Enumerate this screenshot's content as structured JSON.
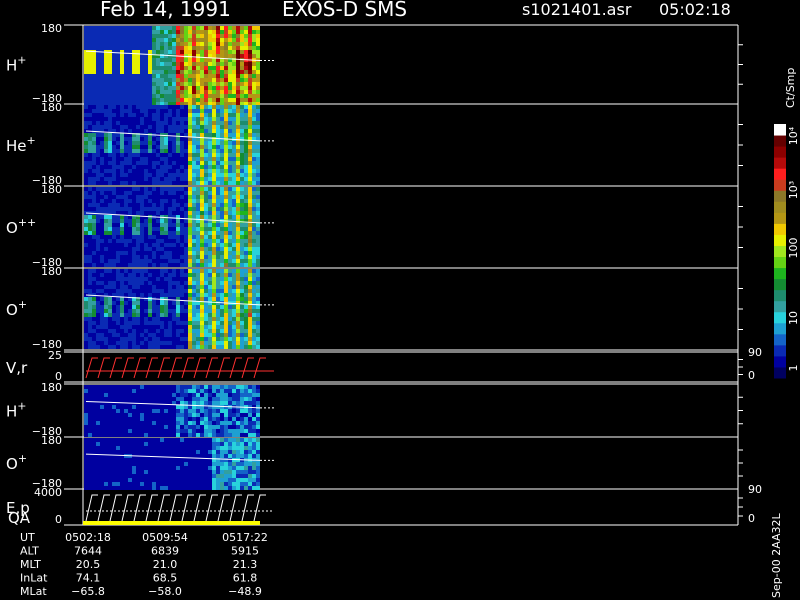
{
  "header": {
    "date": "Feb 14, 1991",
    "instrument": "EXOS-D SMS",
    "file": "s1021401.asr",
    "time": "05:02:18"
  },
  "colors": {
    "background": "#000000",
    "axis": "#ffffff",
    "line": "#ffffff",
    "vr_series": "#ff3030",
    "qa_bar": "#ffff00"
  },
  "colorbar": {
    "unit": "Ct/Smp",
    "tick_labels": [
      "1",
      "10",
      "100",
      "10³",
      "10⁴"
    ],
    "colors": [
      "#000060",
      "#0000a0",
      "#0a2ab4",
      "#1464c8",
      "#1ea0d2",
      "#28d2dc",
      "#32a0a0",
      "#1e8c6e",
      "#148c32",
      "#1eb41e",
      "#64d214",
      "#a0e61e",
      "#e6f000",
      "#f0c800",
      "#b49614",
      "#a08c1e",
      "#8c7828",
      "#c83c1e",
      "#ff1e1e",
      "#b40a0a",
      "#8c0000",
      "#640000",
      "#ffffff"
    ]
  },
  "footer": {
    "rows": [
      {
        "label": "UT",
        "values": [
          "0502:18",
          "0509:54",
          "0517:22"
        ]
      },
      {
        "label": "ALT",
        "values": [
          "7644",
          "6839",
          "5915"
        ]
      },
      {
        "label": "MLT",
        "values": [
          "20.5",
          "21.0",
          "21.3"
        ]
      },
      {
        "label": "InLat",
        "values": [
          "74.1",
          "68.5",
          "61.8"
        ]
      },
      {
        "label": "MLat",
        "values": [
          "−65.8",
          "−58.0",
          "−48.9"
        ]
      }
    ],
    "side_label": "Sep-00  2AA32L"
  },
  "chart_data": {
    "type": "heatmap",
    "time_axis_ticks": [
      "0502:18",
      "0509:54",
      "0517:22"
    ],
    "data_end_time": "0517:22",
    "panels": [
      {
        "label": "H",
        "sup": "+",
        "ymax": "180",
        "ymin": "−180",
        "type": "spectrogram",
        "profile": "strong"
      },
      {
        "label": "He",
        "sup": "+",
        "ymax": "180",
        "ymin": "−180",
        "type": "spectrogram",
        "profile": "medium"
      },
      {
        "label": "O",
        "sup": "++",
        "ymax": "180",
        "ymin": "−180",
        "type": "spectrogram",
        "profile": "medium"
      },
      {
        "label": "O",
        "sup": "+",
        "ymax": "180",
        "ymin": "−180",
        "type": "spectrogram",
        "profile": "medium"
      },
      {
        "label": "V,r",
        "sup": "",
        "ymax": "25",
        "ymin": "0",
        "right_max": "90",
        "right_min": "0",
        "type": "sawtooth",
        "color": "#ff3030"
      },
      {
        "label": "H",
        "sup": "+",
        "ymax": "180",
        "ymin": "−180",
        "type": "spectrogram",
        "profile": "weak"
      },
      {
        "label": "O",
        "sup": "+",
        "ymax": "180",
        "ymin": "−180",
        "type": "spectrogram",
        "profile": "late"
      },
      {
        "label": "E,p",
        "sup": "",
        "label2": "QA",
        "ymax": "4000",
        "ymin": "0",
        "right_max": "90",
        "right_min": "0",
        "type": "sawtooth",
        "color": "#ffffff"
      }
    ]
  }
}
